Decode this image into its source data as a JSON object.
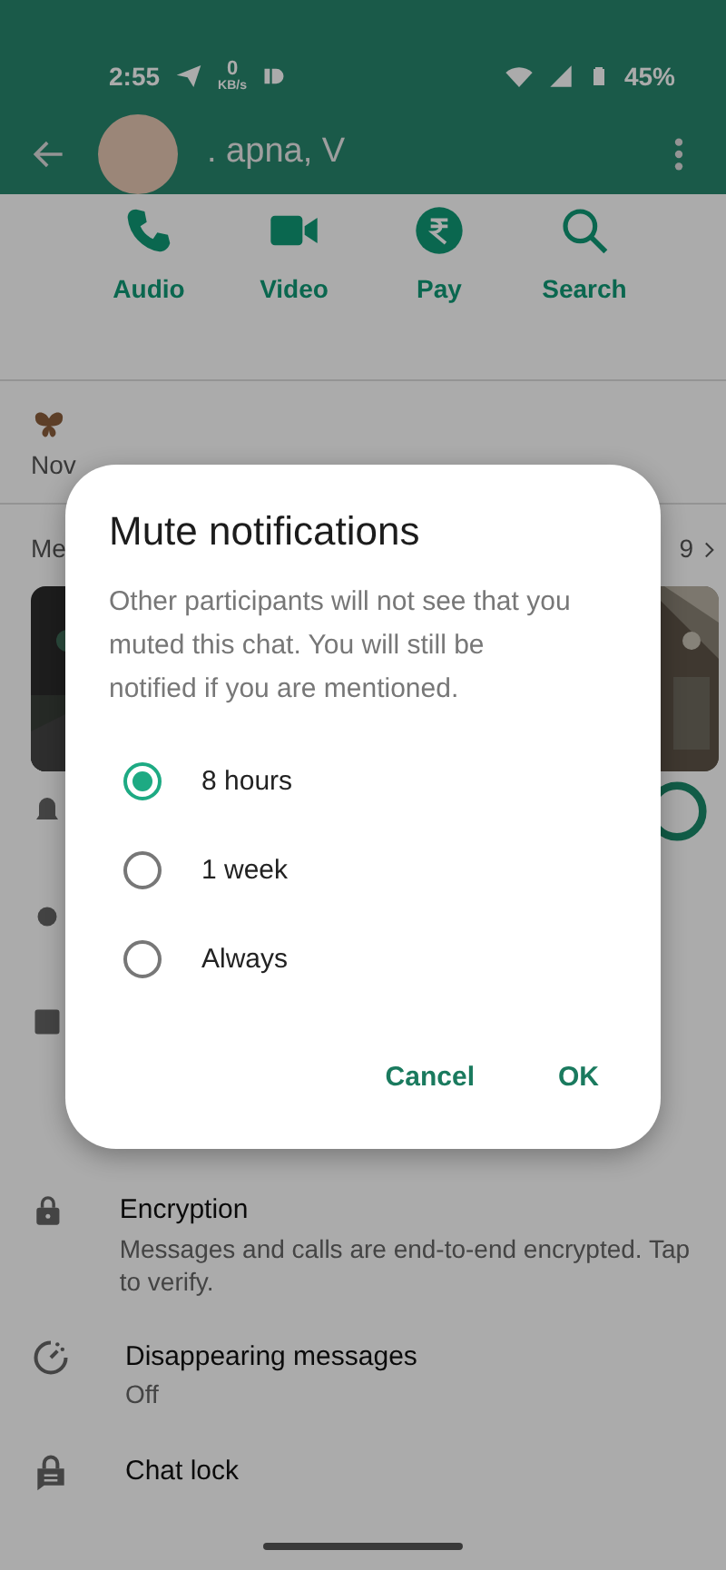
{
  "status_bar": {
    "time": "2:55",
    "speed_value": "0",
    "speed_unit": "KB/s",
    "battery": "45%"
  },
  "header": {
    "title": ". apna, V"
  },
  "actions": [
    {
      "label": "Audio",
      "kind": "phone"
    },
    {
      "label": "Video",
      "kind": "video"
    },
    {
      "label": "Pay",
      "kind": "rupee"
    },
    {
      "label": "Search",
      "kind": "search"
    }
  ],
  "about": {
    "text": "Nov"
  },
  "media": {
    "label": "Me",
    "count": "9"
  },
  "dialog": {
    "title": "Mute notifications",
    "message": "Other participants will not see that you muted this chat. You will still be notified if you are mentioned.",
    "options": [
      {
        "label": "8 hours",
        "selected": true
      },
      {
        "label": "1 week",
        "selected": false
      },
      {
        "label": "Always",
        "selected": false
      }
    ],
    "buttons": [
      "Cancel",
      "OK"
    ]
  },
  "settings": [
    {
      "kind": "lock",
      "title": "Encryption",
      "subtitle": "Messages and calls are end-to-end encrypted. Tap to verify."
    },
    {
      "kind": "timer",
      "title": "Disappearing messages",
      "subtitle": "Off"
    },
    {
      "kind": "chatlock",
      "title": "Chat lock"
    }
  ]
}
